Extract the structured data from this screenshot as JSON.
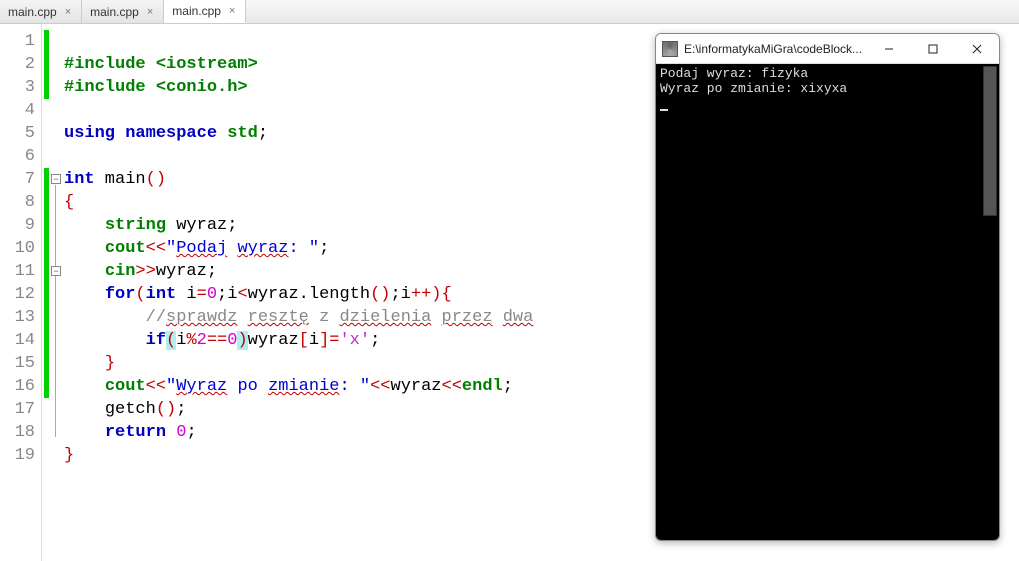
{
  "tabs": [
    {
      "label": "main.cpp",
      "active": false
    },
    {
      "label": "main.cpp",
      "active": false
    },
    {
      "label": "main.cpp",
      "active": true
    }
  ],
  "line_numbers": [
    "1",
    "2",
    "3",
    "4",
    "5",
    "6",
    "7",
    "8",
    "9",
    "10",
    "11",
    "12",
    "13",
    "14",
    "15",
    "16",
    "17",
    "18",
    "19"
  ],
  "code": {
    "l1_pre": "#include <iostream>",
    "l2_pre": "#include <conio.h>",
    "l4_using": "using",
    "l4_ns": "namespace",
    "l4_std": "std",
    "l4_semi": ";",
    "l6_int": "int",
    "l6_main": " main",
    "l6_par": "()",
    "l7_brace": "{",
    "l8_string": "string",
    "l8_rest": " wyraz;",
    "l9_cout": "cout",
    "l9_op1": "<<",
    "l9_str": "\"Podaj wyraz: \"",
    "l9_str_a": "\"",
    "l9_str_b": "Podaj",
    "l9_str_c": " ",
    "l9_str_d": "wyraz",
    "l9_str_e": ": \"",
    "l9_semi": ";",
    "l10_cin": "cin",
    "l10_op": ">>",
    "l10_rest": "wyraz;",
    "l11_for": "for",
    "l11_p1": "(",
    "l11_int": "int",
    "l11_i": " i",
    "l11_eq": "=",
    "l11_zero": "0",
    "l11_semi1": ";i",
    "l11_lt": "<",
    "l11_len": "wyraz.length",
    "l11_par": "()",
    "l11_semi2": ";i",
    "l11_pp": "++",
    "l11_p2": ")",
    "l11_brace": "{",
    "l12_comment_a": "//",
    "l12_comment_b": "sprawdz",
    "l12_comment_c": " ",
    "l12_comment_d": "resztę",
    "l12_comment_e": " z ",
    "l12_comment_f": "dzielenia",
    "l12_comment_g": " ",
    "l12_comment_h": "przez",
    "l12_comment_i": " ",
    "l12_comment_j": "dwa",
    "l13_if": "if",
    "l13_p1": "(",
    "l13_i": "i",
    "l13_mod": "%",
    "l13_two": "2",
    "l13_eq": "==",
    "l13_zero": "0",
    "l13_p2": ")",
    "l13_wy": "wyraz",
    "l13_br1": "[",
    "l13_ib": "i",
    "l13_br2": "]",
    "l13_as": "=",
    "l13_chr": "'x'",
    "l13_semi": ";",
    "l14_brace": "}",
    "l15_cout": "cout",
    "l15_op1": "<<",
    "l15_str_a": "\"",
    "l15_str_b": "Wyraz",
    "l15_str_c": " po ",
    "l15_str_d": "zmianie",
    "l15_str_e": ": \"",
    "l15_op2": "<<",
    "l15_wy": "wyraz",
    "l15_op3": "<<",
    "l15_endl": "endl",
    "l15_semi": ";",
    "l16_getch": "getch",
    "l16_par": "()",
    "l16_semi": ";",
    "l17_return": "return",
    "l17_sp": " ",
    "l17_zero": "0",
    "l17_semi": ";",
    "l18_brace": "}"
  },
  "console": {
    "title": "E:\\informatykaMiGra\\codeBlock...",
    "line1": "Podaj wyraz: fizyka",
    "line2": "Wyraz po zmianie: xixyxa"
  }
}
